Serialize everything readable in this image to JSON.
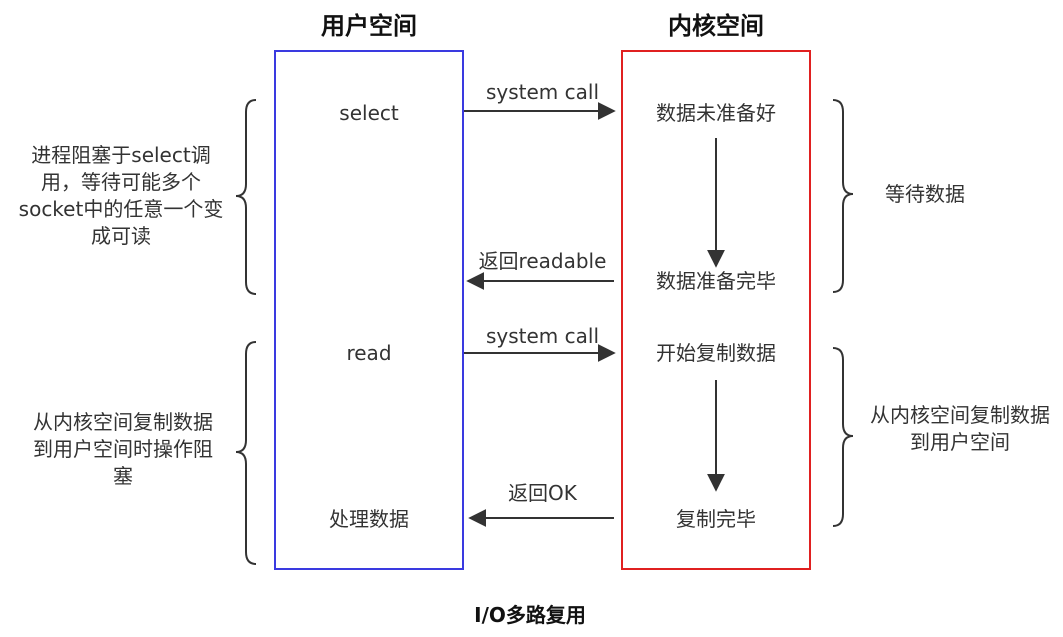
{
  "user_space": {
    "title": "用户空间",
    "border_color": "#3a3ae0",
    "select": "select",
    "read": "read",
    "process_data": "处理数据"
  },
  "kernel_space": {
    "title": "内核空间",
    "border_color": "#e02020",
    "data_not_ready": "数据未准备好",
    "data_ready": "数据准备完毕",
    "start_copy": "开始复制数据",
    "copy_done": "复制完毕"
  },
  "arrows": {
    "syscall_1": "system call",
    "return_readable": "返回readable",
    "syscall_2": "system call",
    "return_ok": "返回OK"
  },
  "left_notes": {
    "blocked_on_select": "进程阻塞于select调用，等待可能多个socket中的任意一个变成可读",
    "blocked_on_copy": "从内核空间复制数据到用户空间时操作阻塞"
  },
  "right_notes": {
    "wait_data": "等待数据",
    "copy_to_user": "从内核空间复制数据到用户空间"
  },
  "caption": "I/O多路复用"
}
